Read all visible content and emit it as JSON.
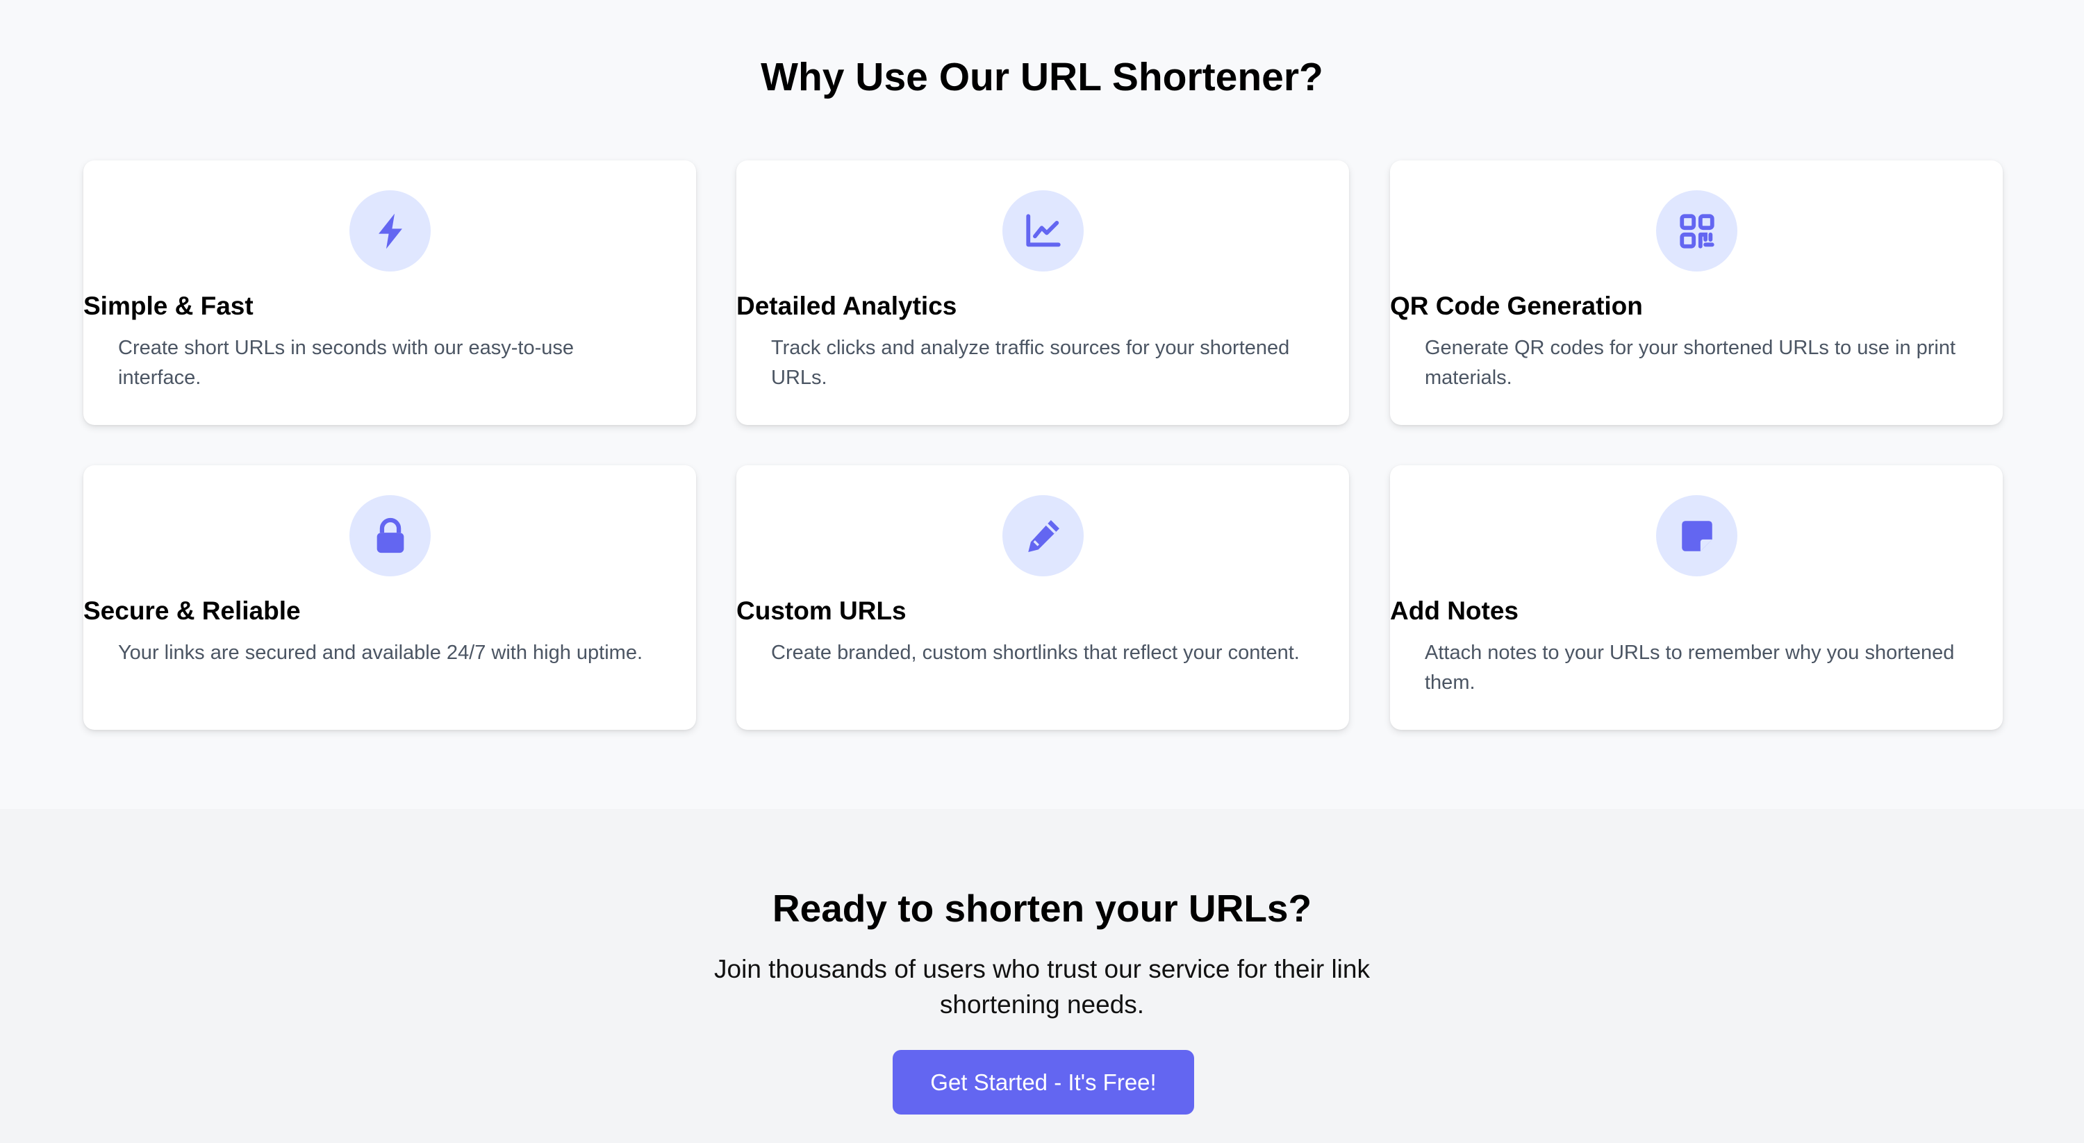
{
  "features": {
    "title": "Why Use Our URL Shortener?",
    "cards": [
      {
        "icon": "lightning-bolt-icon",
        "title": "Simple & Fast",
        "description": "Create short URLs in seconds with our easy-to-use interface."
      },
      {
        "icon": "chart-line-icon",
        "title": "Detailed Analytics",
        "description": "Track clicks and analyze traffic sources for your shortened URLs."
      },
      {
        "icon": "qr-code-icon",
        "title": "QR Code Generation",
        "description": "Generate QR codes for your shortened URLs to use in print materials."
      },
      {
        "icon": "lock-icon",
        "title": "Secure & Reliable",
        "description": "Your links are secured and available 24/7 with high uptime."
      },
      {
        "icon": "pencil-icon",
        "title": "Custom URLs",
        "description": "Create branded, custom shortlinks that reflect your content."
      },
      {
        "icon": "sticky-note-icon",
        "title": "Add Notes",
        "description": "Attach notes to your URLs to remember why you shortened them."
      }
    ]
  },
  "cta": {
    "title": "Ready to shorten your URLs?",
    "subtitle": "Join thousands of users who trust our service for their link shortening needs.",
    "button_label": "Get Started - It's Free!"
  },
  "colors": {
    "accent": "#6366f1",
    "icon_bg": "#e0e7ff",
    "text_muted": "#4b5563"
  }
}
